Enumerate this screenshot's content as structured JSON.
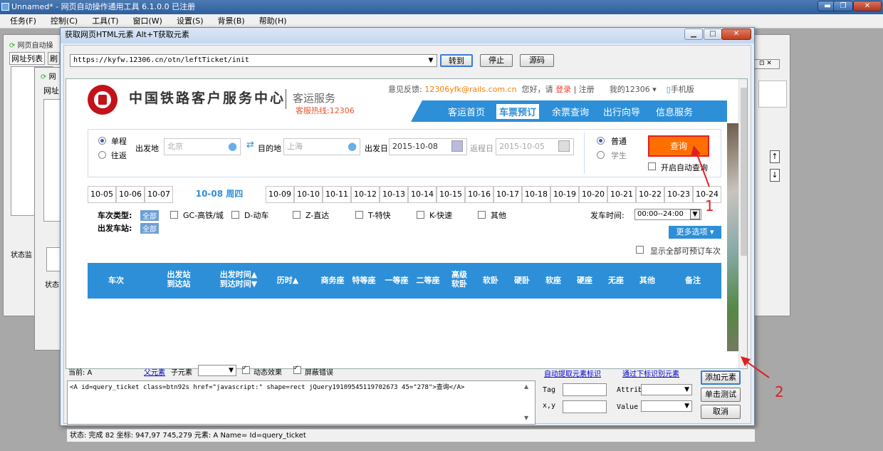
{
  "main_window": {
    "title": "Unnamed* - 网页自动操作通用工具 6.1.0.0 已注册",
    "menu": [
      "任务(F)",
      "控制(C)",
      "工具(T)",
      "窗口(W)",
      "设置(S)",
      "背景(B)",
      "帮助(H)"
    ],
    "min": "▬",
    "max": "❐",
    "close": "✕"
  },
  "bg_windows": {
    "w1_title": "网页自动操",
    "w1_tab1": "网址列表",
    "w1_tab2": "刷",
    "w1_status": "状态监",
    "w2_title": "网",
    "w2_tab": "网址",
    "w2_status": "状态"
  },
  "dialog": {
    "title": "获取网页HTML元素  Alt+T获取元素",
    "url": "https://kyfw.12306.cn/otn/leftTicket/init",
    "btn_go": "转到",
    "btn_stop": "停止",
    "btn_source": "源码"
  },
  "site": {
    "title": "中国铁路客户服务中心",
    "subtitle": "客运服务",
    "hotline": "客服热线:12306",
    "feedback_label": "意见反馈:",
    "feedback_email": "12306yfk@rails.com.cn",
    "greeting": "您好，请",
    "login": "登录",
    "register": "注册",
    "my12306": "我的12306",
    "mobile": "手机版",
    "nav": [
      "客运首页",
      "车票预订",
      "余票查询",
      "出行向导",
      "信息服务"
    ]
  },
  "search": {
    "one_way": "单程",
    "round_trip": "往返",
    "from_label": "出发地",
    "from_value": "北京",
    "to_label": "目的地",
    "to_value": "上海",
    "date_label": "出发日",
    "date_value": "2015-10-08",
    "return_label": "返程日",
    "return_value": "2015-10-05",
    "normal": "普通",
    "student": "学生",
    "query": "查询",
    "auto_query": "开启自动查询"
  },
  "dates": [
    "10-05",
    "10-06",
    "10-07",
    "10-08 周四",
    "10-09",
    "10-10",
    "10-11",
    "10-12",
    "10-13",
    "10-14",
    "10-15",
    "10-16",
    "10-17",
    "10-18",
    "10-19",
    "10-20",
    "10-21",
    "10-22",
    "10-23",
    "10-24"
  ],
  "filter": {
    "type_label": "车次类型:",
    "all": "全部",
    "types": [
      "GC-高铁/城",
      "D-动车",
      "Z-直达",
      "T-特快",
      "K-快速",
      "其他"
    ],
    "station_label": "出发车站:",
    "time_label": "发车时间:",
    "time_value": "00:00--24:00",
    "more": "更多选项",
    "show_all": "显示全部可预订车次"
  },
  "table_headers": [
    "车次",
    "出发站\n到达站",
    "出发时间▲\n到达时间▼",
    "历时▲",
    "商务座",
    "特等座",
    "一等座",
    "二等座",
    "高级\n软卧",
    "软卧",
    "硬卧",
    "软座",
    "硬座",
    "无座",
    "其他",
    "备注"
  ],
  "bottom": {
    "current_label": "当前: A",
    "parent": "父元素",
    "child": "子元素",
    "dynamic": "动态效果",
    "mask_error": "屏蔽错误",
    "auto_grab": "自动提取元素标识",
    "by_index": "通过下标识别元素",
    "code": "<A id=query_ticket class=btn92s href=\"javascript:\" shape=rect jQuery19109545119702673 45=\"278\">查询</A>",
    "tag": "Tag",
    "attrib": "Attrib",
    "xy": "x,y",
    "value": "Value",
    "add": "添加元素",
    "test": "单击测试",
    "cancel": "取消",
    "status": "状态: 完成  82  坐标: 947,97  745,279  元素: A Name= Id=query_ticket"
  },
  "annotations": [
    "1",
    "2"
  ],
  "colors": {
    "accent": "#2d8fd8",
    "query_btn": "#ff6f00",
    "highlight": "#e32020"
  }
}
